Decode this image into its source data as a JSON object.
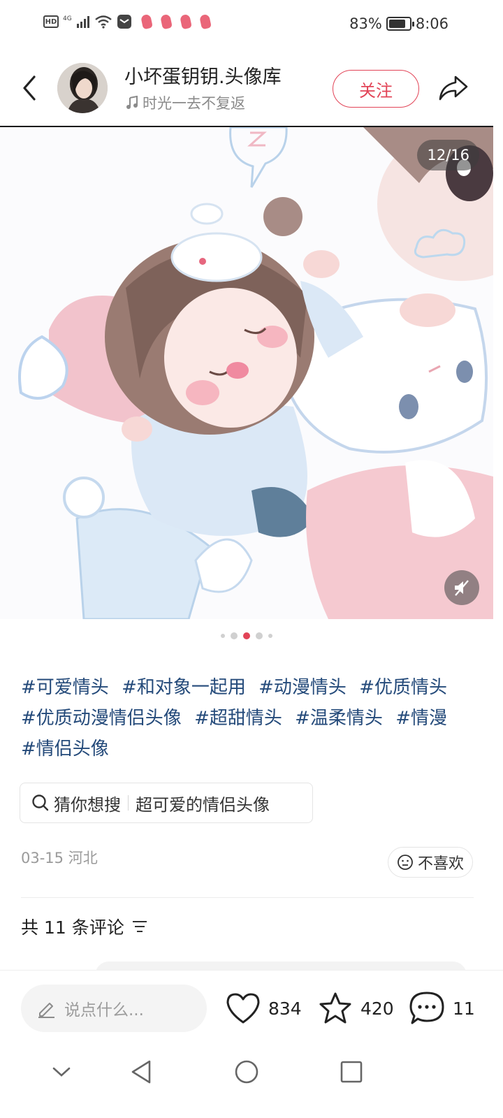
{
  "status_bar": {
    "hd": "HD",
    "network": "4G",
    "battery_percent": "83%",
    "battery_level": 0.83,
    "time": "8:06"
  },
  "header": {
    "author_name": "小坏蛋钥钥.头像库",
    "music_text": "时光一去不复返",
    "follow_label": "关注",
    "icons": [
      "back-icon",
      "music-note-icon",
      "share-icon"
    ]
  },
  "image": {
    "page_counter": "12/16",
    "icons": [
      "mute-icon"
    ]
  },
  "pagination": {
    "count": 5,
    "active_index": 2,
    "active_color": "#e24457"
  },
  "tags": [
    "#可爱情头",
    "#和对象一起用",
    "#动漫情头",
    "#优质情头",
    "#优质动漫情侣头像",
    "#超甜情头",
    "#温柔情头",
    "#情漫",
    "#情侣头像"
  ],
  "suggest": {
    "label": "猜你想搜",
    "query": "超可爱的情侣头像"
  },
  "meta": {
    "date_location": "03-15 河北",
    "dislike_label": "不喜欢"
  },
  "comments": {
    "count_label": "共 11 条评论"
  },
  "action_bar": {
    "input_placeholder": "说点什么...",
    "likes": "834",
    "favorites": "420",
    "comments": "11"
  },
  "colors": {
    "accent": "#e24457",
    "tag": "#244a7a"
  }
}
